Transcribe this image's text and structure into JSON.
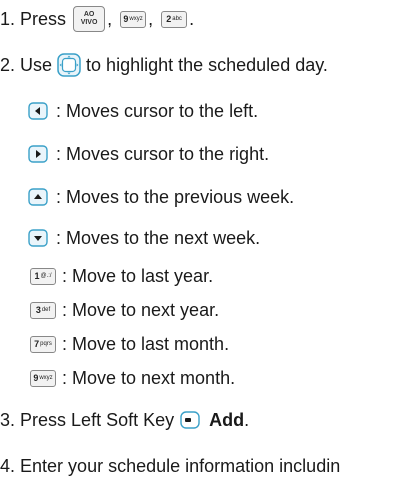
{
  "steps": {
    "s1": {
      "number": "1.",
      "text": "Press",
      "sep1": ",",
      "sep2": ",",
      "end": "."
    },
    "s2": {
      "number": "2.",
      "pre": "Use",
      "post": "to highlight the scheduled day."
    },
    "s3": {
      "number": "3.",
      "pre": "Press Left Soft Key",
      "bold": "Add",
      "end": "."
    },
    "s4": {
      "number": "4.",
      "text": "Enter your schedule information includin"
    }
  },
  "keys": {
    "ao_top": "AO",
    "ao_bottom": "VIVO",
    "k9_num": "9",
    "k9_letters": "wxyz",
    "k2_num": "2",
    "k2_letters": "abc",
    "k1_num": "1",
    "k1_letters": "@.:/",
    "k3_num": "3",
    "k3_letters": "def",
    "k7_num": "7",
    "k7_letters": "pqrs"
  },
  "nav_items": [
    {
      "icon": "nav-left-key-icon",
      "text": ": Moves cursor to the left."
    },
    {
      "icon": "nav-right-key-icon",
      "text": ": Moves cursor to the right."
    },
    {
      "icon": "nav-up-key-icon",
      "text": ": Moves to the previous week."
    },
    {
      "icon": "nav-down-key-icon",
      "text": ": Moves to the next week."
    }
  ],
  "num_items": [
    {
      "icon": "key-1-icon",
      "text": ": Move to last year."
    },
    {
      "icon": "key-3-icon",
      "text": ": Move to next year."
    },
    {
      "icon": "key-7-icon",
      "text": ": Move to last month."
    },
    {
      "icon": "key-9-icon",
      "text": ": Move to next month."
    }
  ],
  "colors": {
    "text": "#1a1a1a",
    "key_border": "#888888",
    "key_fill": "#f2f2f2",
    "nav_accent": "#3aa0c8"
  }
}
